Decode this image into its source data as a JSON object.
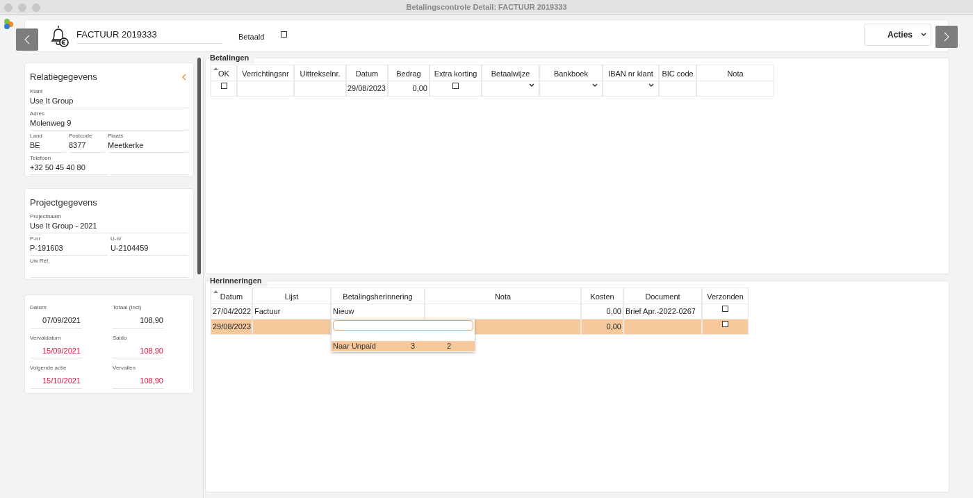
{
  "window": {
    "title": "Betalingscontrole Detail: FACTUUR 2019333"
  },
  "header": {
    "document": "FACTUUR 2019333",
    "paid_label": "Betaald",
    "paid_checked": false,
    "actions": "Acties"
  },
  "relatie": {
    "title": "Relatiegegevens",
    "rows": [
      [
        {
          "label": "Klant",
          "value": "Use It Group"
        }
      ],
      [
        {
          "label": "Adres",
          "value": "Molenweg 9"
        }
      ],
      [
        {
          "label": "Land",
          "value": "BE"
        },
        {
          "label": "Postcode",
          "value": "8377"
        },
        {
          "label": "Plaats",
          "value": "Meetkerke"
        }
      ],
      [
        {
          "label": "Telefoon",
          "value": "+32 50 45 40 80"
        },
        {}
      ]
    ]
  },
  "project": {
    "title": "Projectgegevens",
    "rows": [
      [
        {
          "label": "Projectnaam",
          "value": "Use It Group - 2021"
        }
      ],
      [
        {
          "label": "P-nr",
          "value": "P-191603"
        },
        {
          "label": "U-nr",
          "value": "U-2104459"
        }
      ],
      [
        {
          "label": "Uw Ref."
        }
      ]
    ]
  },
  "totals": [
    {
      "label": "Datum",
      "value": "07/09/2021",
      "overdue": false
    },
    {
      "label": "Totaal (Incl)",
      "value": "108,90",
      "overdue": false
    },
    {
      "label": "Vervaldatum",
      "value": "15/09/2021",
      "overdue": true
    },
    {
      "label": "Saldo",
      "value": "108,90",
      "overdue": true
    },
    {
      "label": "Volgende actie",
      "value": "15/10/2021",
      "overdue": true
    },
    {
      "label": "Vervallen",
      "value": "108,90",
      "overdue": true
    }
  ],
  "payments": {
    "title": "Betalingen",
    "columns": [
      "OK",
      "Verrichtingsnr",
      "Uittrekselnr.",
      "Datum",
      "Bedrag",
      "Extra korting",
      "Betaalwijze",
      "Bankboek",
      "IBAN nr klant",
      "BIC code",
      "Nota"
    ],
    "rows": [
      {
        "selected": false,
        "cells": [
          {
            "kind": "checkbox",
            "checked": false
          },
          {
            "kind": "empty"
          },
          {
            "kind": "empty"
          },
          {
            "kind": "text",
            "value": "29/08/2023"
          },
          {
            "kind": "text",
            "value": "0,00"
          },
          {
            "kind": "checkbox",
            "checked": false
          },
          {
            "kind": "select"
          },
          {
            "kind": "select"
          },
          {
            "kind": "select"
          },
          {
            "kind": "empty"
          },
          {
            "kind": "empty"
          }
        ]
      }
    ]
  },
  "reminders": {
    "title": "Herinneringen",
    "columns": [
      "Datum",
      "Lijst",
      "Betalingsherinnering",
      "Nota",
      "Kosten",
      "Document",
      "Verzonden"
    ],
    "rows": [
      {
        "selected": false,
        "cells": [
          {
            "kind": "text",
            "value": "27/04/2022"
          },
          {
            "kind": "text",
            "value": "Factuur"
          },
          {
            "kind": "text",
            "value": "Nieuw"
          },
          {
            "kind": "empty"
          },
          {
            "kind": "text",
            "value": "0,00"
          },
          {
            "kind": "text",
            "value": "Brief Apr.-2022-0267"
          },
          {
            "kind": "checkbox",
            "checked": false
          }
        ]
      },
      {
        "selected": true,
        "cells": [
          {
            "kind": "text",
            "value": "29/08/2023"
          },
          {
            "kind": "empty"
          },
          {
            "kind": "dropdown",
            "options": [
              {
                "label": "Naar Unpaid",
                "column_2": "3",
                "column_3": "2",
                "selected": true
              }
            ]
          },
          {
            "kind": "empty"
          },
          {
            "kind": "text",
            "value": "0,00"
          },
          {
            "kind": "empty"
          },
          {
            "kind": "checkbox",
            "checked": false
          }
        ]
      }
    ]
  }
}
